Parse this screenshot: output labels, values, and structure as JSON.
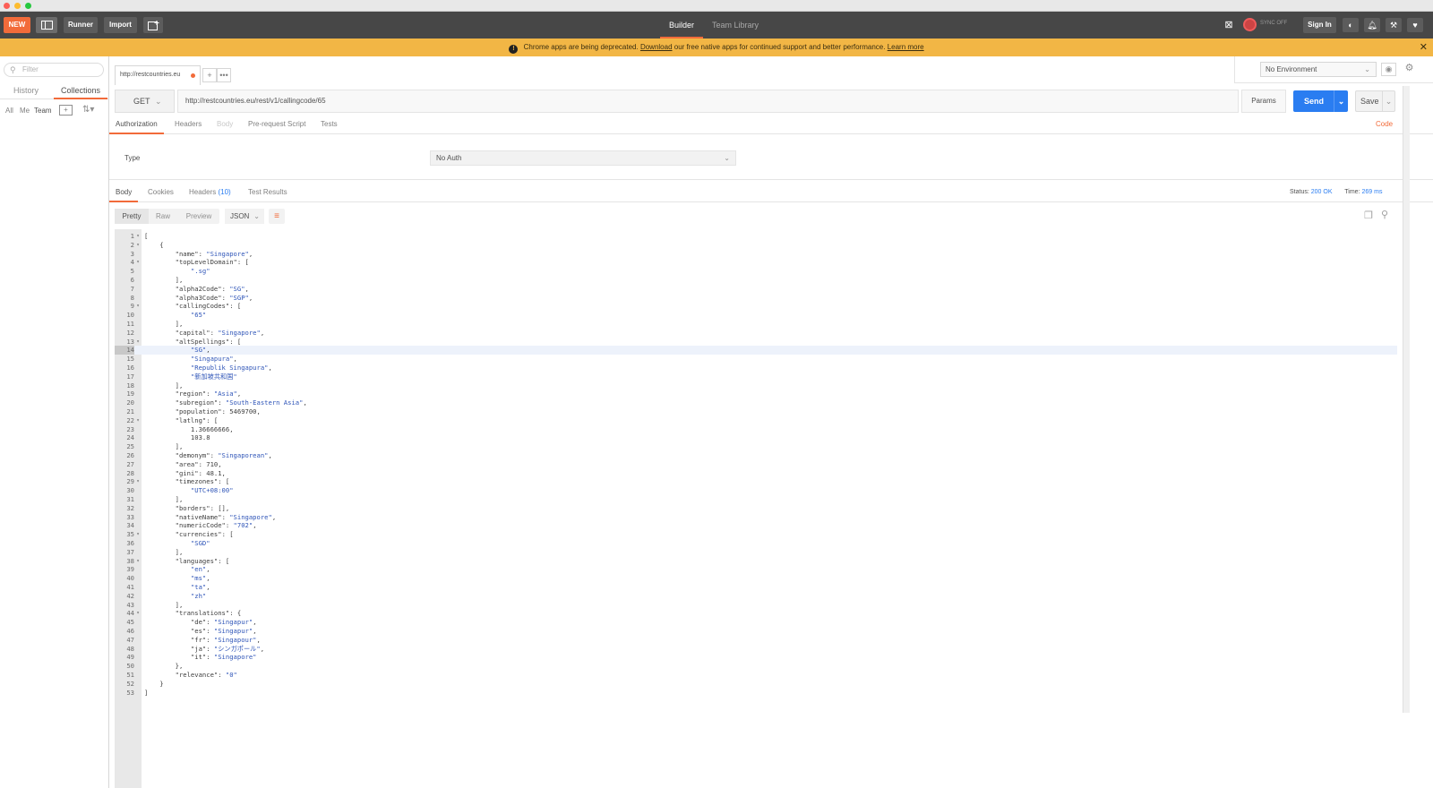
{
  "colors": {
    "accent": "#f26b3a",
    "send": "#2a7df1",
    "banner": "#f2b645",
    "string": "#2f55b8"
  },
  "header": {
    "new_label": "NEW",
    "runner_label": "Runner",
    "import_label": "Import",
    "tab_builder": "Builder",
    "tab_team_library": "Team Library",
    "sync_label": "SYNC OFF",
    "signin_label": "Sign In"
  },
  "banner": {
    "prefix": "Chrome apps are being deprecated.",
    "download": "Download",
    "middle": "our free native apps for continued support and better performance.",
    "learn_more": "Learn more"
  },
  "sidebar": {
    "filter_placeholder": "Filter",
    "tab_history": "History",
    "tab_collections": "Collections",
    "tool_all": "All",
    "tool_me": "Me",
    "tool_team": "Team"
  },
  "request": {
    "tab_title": "http://restcountries.eu",
    "method": "GET",
    "url": "http://restcountries.eu/rest/v1/callingcode/65",
    "params_label": "Params",
    "send_label": "Send",
    "save_label": "Save",
    "environment": "No Environment"
  },
  "request_tabs": {
    "authorization": "Authorization",
    "headers": "Headers",
    "body": "Body",
    "prerequest": "Pre-request Script",
    "tests": "Tests",
    "code": "Code"
  },
  "auth": {
    "type_label": "Type",
    "type_value": "No Auth"
  },
  "response": {
    "tab_body": "Body",
    "tab_cookies": "Cookies",
    "tab_headers": "Headers",
    "headers_count": "(10)",
    "tab_tests": "Test Results",
    "status_label": "Status:",
    "status_value": "200 OK",
    "time_label": "Time:",
    "time_value": "269 ms",
    "fmt_pretty": "Pretty",
    "fmt_raw": "Raw",
    "fmt_preview": "Preview",
    "fmt_json": "JSON"
  },
  "code_lines": [
    {
      "n": "1",
      "f": "▾",
      "t": "["
    },
    {
      "n": "2",
      "f": "▾",
      "t": "    {"
    },
    {
      "n": "3",
      "f": "",
      "t": "        \"name\": \"Singapore\","
    },
    {
      "n": "4",
      "f": "▾",
      "t": "        \"topLevelDomain\": ["
    },
    {
      "n": "5",
      "f": "",
      "t": "            \".sg\""
    },
    {
      "n": "6",
      "f": "",
      "t": "        ],"
    },
    {
      "n": "7",
      "f": "",
      "t": "        \"alpha2Code\": \"SG\","
    },
    {
      "n": "8",
      "f": "",
      "t": "        \"alpha3Code\": \"SGP\","
    },
    {
      "n": "9",
      "f": "▾",
      "t": "        \"callingCodes\": ["
    },
    {
      "n": "10",
      "f": "",
      "t": "            \"65\""
    },
    {
      "n": "11",
      "f": "",
      "t": "        ],"
    },
    {
      "n": "12",
      "f": "",
      "t": "        \"capital\": \"Singapore\","
    },
    {
      "n": "13",
      "f": "▾",
      "t": "        \"altSpellings\": ["
    },
    {
      "n": "14",
      "f": "",
      "t": "            \"SG\","
    },
    {
      "n": "15",
      "f": "",
      "t": "            \"Singapura\","
    },
    {
      "n": "16",
      "f": "",
      "t": "            \"Republik Singapura\","
    },
    {
      "n": "17",
      "f": "",
      "t": "            \"新加坡共和国\""
    },
    {
      "n": "18",
      "f": "",
      "t": "        ],"
    },
    {
      "n": "19",
      "f": "",
      "t": "        \"region\": \"Asia\","
    },
    {
      "n": "20",
      "f": "",
      "t": "        \"subregion\": \"South-Eastern Asia\","
    },
    {
      "n": "21",
      "f": "",
      "t": "        \"population\": 5469700,"
    },
    {
      "n": "22",
      "f": "▾",
      "t": "        \"latlng\": ["
    },
    {
      "n": "23",
      "f": "",
      "t": "            1.36666666,"
    },
    {
      "n": "24",
      "f": "",
      "t": "            103.8"
    },
    {
      "n": "25",
      "f": "",
      "t": "        ],"
    },
    {
      "n": "26",
      "f": "",
      "t": "        \"demonym\": \"Singaporean\","
    },
    {
      "n": "27",
      "f": "",
      "t": "        \"area\": 710,"
    },
    {
      "n": "28",
      "f": "",
      "t": "        \"gini\": 48.1,"
    },
    {
      "n": "29",
      "f": "▾",
      "t": "        \"timezones\": ["
    },
    {
      "n": "30",
      "f": "",
      "t": "            \"UTC+08:00\""
    },
    {
      "n": "31",
      "f": "",
      "t": "        ],"
    },
    {
      "n": "32",
      "f": "",
      "t": "        \"borders\": [],"
    },
    {
      "n": "33",
      "f": "",
      "t": "        \"nativeName\": \"Singapore\","
    },
    {
      "n": "34",
      "f": "",
      "t": "        \"numericCode\": \"702\","
    },
    {
      "n": "35",
      "f": "▾",
      "t": "        \"currencies\": ["
    },
    {
      "n": "36",
      "f": "",
      "t": "            \"SGD\""
    },
    {
      "n": "37",
      "f": "",
      "t": "        ],"
    },
    {
      "n": "38",
      "f": "▾",
      "t": "        \"languages\": ["
    },
    {
      "n": "39",
      "f": "",
      "t": "            \"en\","
    },
    {
      "n": "40",
      "f": "",
      "t": "            \"ms\","
    },
    {
      "n": "41",
      "f": "",
      "t": "            \"ta\","
    },
    {
      "n": "42",
      "f": "",
      "t": "            \"zh\""
    },
    {
      "n": "43",
      "f": "",
      "t": "        ],"
    },
    {
      "n": "44",
      "f": "▾",
      "t": "        \"translations\": {"
    },
    {
      "n": "45",
      "f": "",
      "t": "            \"de\": \"Singapur\","
    },
    {
      "n": "46",
      "f": "",
      "t": "            \"es\": \"Singapur\","
    },
    {
      "n": "47",
      "f": "",
      "t": "            \"fr\": \"Singapour\","
    },
    {
      "n": "48",
      "f": "",
      "t": "            \"ja\": \"シンガポール\","
    },
    {
      "n": "49",
      "f": "",
      "t": "            \"it\": \"Singapore\""
    },
    {
      "n": "50",
      "f": "",
      "t": "        },"
    },
    {
      "n": "51",
      "f": "",
      "t": "        \"relevance\": \"0\""
    },
    {
      "n": "52",
      "f": "",
      "t": "    }"
    },
    {
      "n": "53",
      "f": "",
      "t": "]"
    }
  ]
}
